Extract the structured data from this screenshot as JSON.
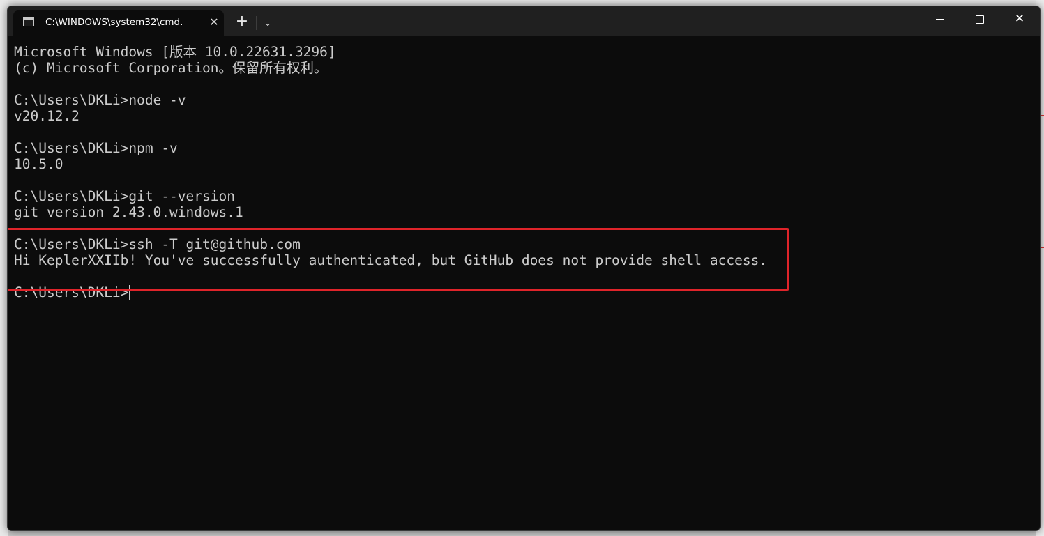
{
  "window": {
    "tab_title": "C:\\WINDOWS\\system32\\cmd.",
    "tab_icon": "terminal-icon",
    "tab_close_glyph": "✕",
    "new_tab_glyph": "+",
    "dropdown_glyph": "⌄",
    "close_glyph": "✕"
  },
  "terminal": {
    "lines": [
      "Microsoft Windows [版本 10.0.22631.3296]",
      "(c) Microsoft Corporation。保留所有权利。",
      "",
      "C:\\Users\\DKLi>node -v",
      "v20.12.2",
      "",
      "C:\\Users\\DKLi>npm -v",
      "10.5.0",
      "",
      "C:\\Users\\DKLi>git --version",
      "git version 2.43.0.windows.1",
      "",
      "C:\\Users\\DKLi>ssh -T git@github.com",
      "Hi KeplerXXIIb! You've successfully authenticated, but GitHub does not provide shell access.",
      "",
      "C:\\Users\\DKLi>"
    ],
    "foreground": "#cccccc",
    "background": "#0c0c0c"
  },
  "annotation": {
    "color": "#e0242a"
  }
}
